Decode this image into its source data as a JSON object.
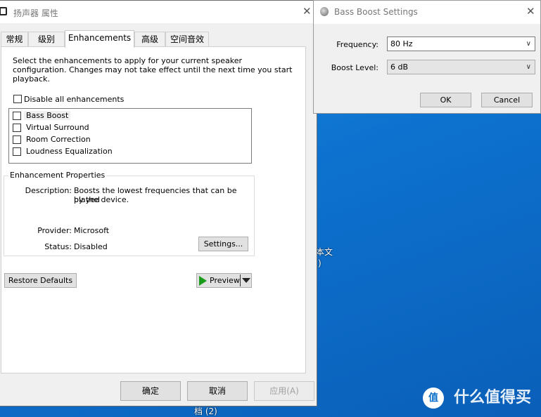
{
  "main_window": {
    "title": "扬声器 属性",
    "close_glyph": "✕",
    "tabs": [
      {
        "label": "常规"
      },
      {
        "label": "级别"
      },
      {
        "label": "Enhancements"
      },
      {
        "label": "高级"
      },
      {
        "label": "空间音效"
      }
    ],
    "intro_line1": "Select the enhancements to apply for your current speaker",
    "intro_line2": "configuration. Changes may not take effect until the next time you start",
    "intro_line3": "playback.",
    "disable_all_label": "Disable all enhancements",
    "enhancements": [
      {
        "label": "Bass Boost",
        "checked": false
      },
      {
        "label": "Virtual Surround",
        "checked": false
      },
      {
        "label": "Room Correction",
        "checked": false
      },
      {
        "label": "Loudness Equalization",
        "checked": false
      }
    ],
    "properties": {
      "group_label": "Enhancement Properties",
      "description_label": "Description:",
      "description_line1": "Boosts the lowest frequencies that can be played",
      "description_line2": "by the device.",
      "provider_label": "Provider:",
      "provider_value": "Microsoft",
      "status_label": "Status:",
      "status_value": "Disabled",
      "settings_button": "Settings..."
    },
    "restore_defaults_button": "Restore Defaults",
    "preview_button": "Preview",
    "ok_button": "确定",
    "cancel_button": "取消",
    "apply_button": "应用(A)"
  },
  "bass_boost_window": {
    "title": "Bass Boost Settings",
    "close_glyph": "✕",
    "frequency_label": "Frequency:",
    "frequency_value": "80 Hz",
    "boost_level_label": "Boost Level:",
    "boost_level_value": "6 dB",
    "ok_button": "OK",
    "cancel_button": "Cancel"
  },
  "desktop": {
    "icon_label_fragment": "本文",
    "icon_label_fragment2": ")",
    "icon_label_bottom": "档 (2)",
    "watermark": "什么值得买",
    "watermark_badge": "值"
  },
  "colors": {
    "desktop_blue": "#0d72cf",
    "preview_green": "#1a9a1a"
  }
}
